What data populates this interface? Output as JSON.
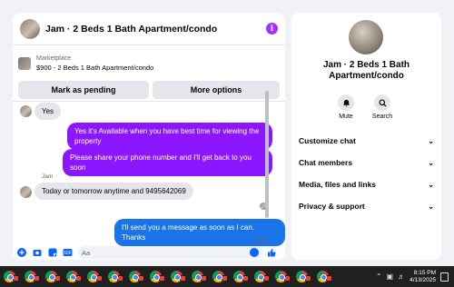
{
  "header": {
    "title": "Jam · 2 Beds 1 Bath Apartment/condo",
    "info_icon": "info-icon"
  },
  "listing": {
    "source": "Marketplace",
    "price_title": "$900 - 2 Beds 1 Bath Apartment/condo"
  },
  "actions": {
    "mark_pending": "Mark as pending",
    "more_options": "More options"
  },
  "messages": [
    {
      "from": "other",
      "text": "Yes"
    },
    {
      "from": "me",
      "text": "Yes it's Available when you have best time for viewing the property"
    },
    {
      "from": "me",
      "text": "Please share your phone number and I'll get back to you soon"
    },
    {
      "from": "other",
      "sender": "Jam",
      "text": "Today or tomorrow anytime and 9495642069"
    },
    {
      "from": "me",
      "text": "I'll send you a message as soon as I can. Thanks",
      "status": "Sent"
    }
  ],
  "composer": {
    "placeholder": "Aa"
  },
  "info": {
    "name": "Jam · 2 Beds 1 Bath Apartment/condo",
    "mute_label": "Mute",
    "search_label": "Search",
    "menu": [
      "Customize chat",
      "Chat members",
      "Media, files and links",
      "Privacy & support"
    ]
  },
  "taskbar": {
    "time": "8:15 PM",
    "date": "4/13/2025"
  },
  "colors": {
    "accent_purple": "#8b16ff",
    "accent_blue": "#1a73e8",
    "fb_blue": "#0866ff"
  }
}
